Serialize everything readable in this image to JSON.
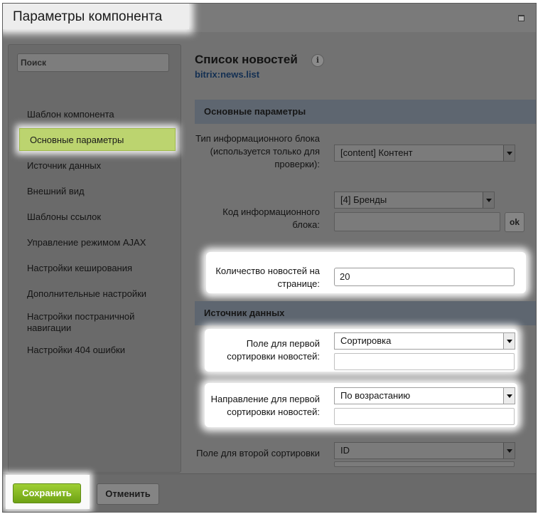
{
  "window": {
    "title": "Параметры компонента"
  },
  "sidebar": {
    "search_placeholder": "Поиск",
    "items": [
      {
        "label": "Шаблон компонента"
      },
      {
        "label": "Основные параметры",
        "active": true
      },
      {
        "label": "Источник данных"
      },
      {
        "label": "Внешний вид"
      },
      {
        "label": "Шаблоны ссылок"
      },
      {
        "label": "Управление режимом AJAX"
      },
      {
        "label": "Настройки кеширования"
      },
      {
        "label": "Дополнительные настройки"
      },
      {
        "label": "Настройки постраничной навигации"
      },
      {
        "label": "Настройки 404 ошибки"
      }
    ]
  },
  "component": {
    "title": "Список новостей",
    "info_icon_glyph": "i",
    "code": "bitrix:news.list"
  },
  "sections": {
    "basic": "Основные параметры",
    "datasource": "Источник данных"
  },
  "fields": {
    "iblock_type": {
      "label": "Тип информационного блока (используется только для проверки):",
      "value": "[content] Контент"
    },
    "iblock_code": {
      "label": "Код информационного блока:",
      "value": "[4] Бренды",
      "ok_label": "ok"
    },
    "news_count": {
      "label": "Количество новостей на странице:",
      "value": "20"
    },
    "sort_by1": {
      "label": "Поле для первой сортировки новостей:",
      "value": "Сортировка"
    },
    "sort_order1": {
      "label": "Направление для первой сортировки новостей:",
      "value": "По возрастанию"
    },
    "sort_by2": {
      "label": "Поле для второй сортировки",
      "value": "ID"
    }
  },
  "footer": {
    "save_label": "Сохранить",
    "cancel_label": "Отменить"
  },
  "colors": {
    "save_button": "#7fb51c",
    "active_nav": "#bcd46f",
    "code_link": "#132f52"
  }
}
